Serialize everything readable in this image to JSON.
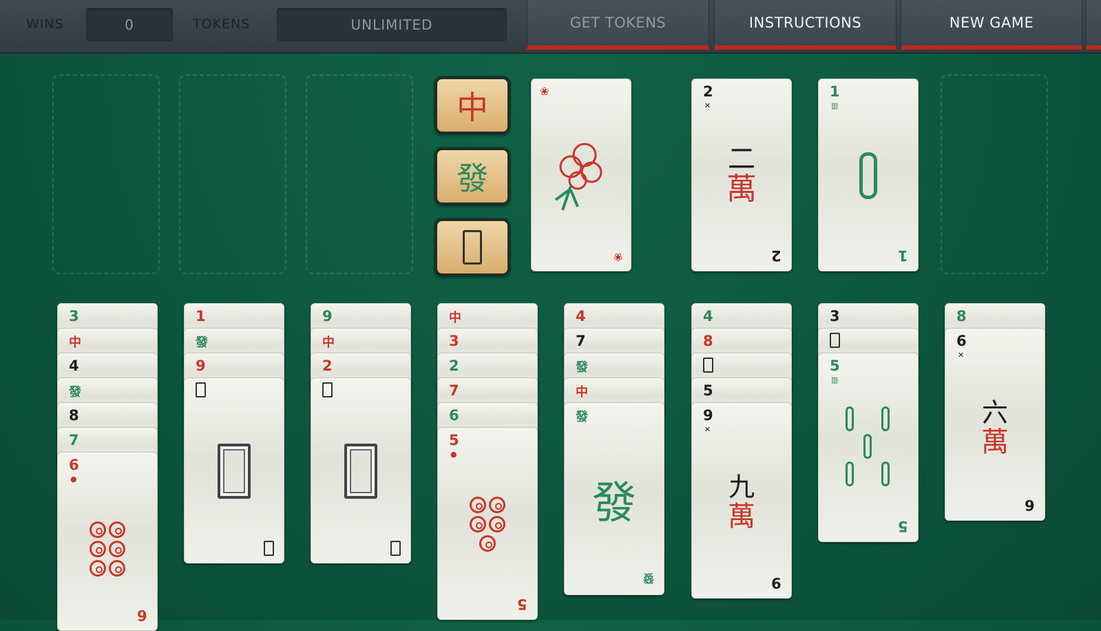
{
  "topbar": {
    "wins_label": "WINS",
    "wins_value": "0",
    "tokens_label": "TOKENS",
    "tokens_value": "UNLIMITED",
    "get_tokens": "GET TOKENS",
    "instructions": "INSTRUCTIONS",
    "new_game": "NEW GAME"
  },
  "dragons": {
    "red": "中",
    "green": "發"
  },
  "foundation": {
    "flower": {
      "corner": "❀"
    },
    "wan": {
      "value": "2",
      "suit_hanzi": "二",
      "suit_char": "萬"
    },
    "bamboo": {
      "value": "1"
    }
  },
  "columns": [
    {
      "stack": [
        "3",
        "中",
        "4",
        "發",
        "8",
        "7"
      ],
      "top": {
        "value": "6"
      }
    },
    {
      "stack": [
        "1",
        "發",
        "9"
      ],
      "top": {}
    },
    {
      "stack": [
        "9",
        "中",
        "2"
      ],
      "top": {}
    },
    {
      "stack": [
        "中",
        "3",
        "2",
        "7",
        "6"
      ],
      "top": {
        "value": "5"
      }
    },
    {
      "stack": [
        "4",
        "7",
        "發",
        "中"
      ],
      "top": {
        "glyph": "發"
      }
    },
    {
      "stack": [
        "4",
        "8",
        "",
        "5"
      ],
      "top": {
        "value": "9",
        "hanzi": "九",
        "char": "萬"
      }
    },
    {
      "stack": [
        "3",
        ""
      ],
      "top": {
        "value": "5"
      }
    },
    {
      "stack": [
        "8"
      ],
      "top": {
        "value": "6",
        "hanzi": "六",
        "char": "萬"
      }
    }
  ],
  "colors": {
    "felt": "#0d5a40",
    "accent": "#c0261d",
    "red_suit": "#c8372a",
    "green_suit": "#2a8a5c"
  }
}
